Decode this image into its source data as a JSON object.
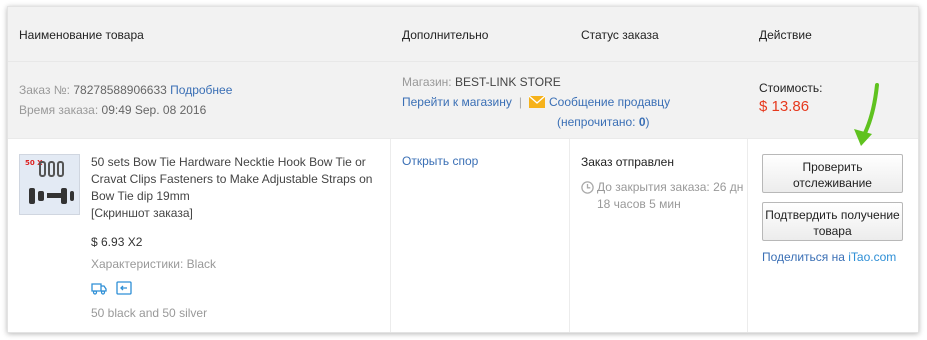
{
  "header": {
    "product_col": "Наименование товара",
    "extra_col": "Дополнительно",
    "status_col": "Статус заказа",
    "action_col": "Действие"
  },
  "order": {
    "number_label": "Заказ №:",
    "number": "78278588906633",
    "details_link": "Подробнее",
    "time_label": "Время заказа:",
    "time": "09:49 Sep. 08 2016",
    "store_label": "Магазин:",
    "store_name": "BEST-LINK STORE",
    "go_to_store": "Перейти к магазину",
    "separator": "|",
    "message_seller": "Сообщение продавцу",
    "unread_prefix": "(непрочитано:",
    "unread_count": "0",
    "unread_suffix": ")",
    "cost_label": "Стоимость:",
    "cost": "$ 13.86"
  },
  "product": {
    "image_badge": "50 X",
    "title": "50 sets Bow Tie Hardware Necktie Hook Bow Tie or Cravat Clips Fasteners to Make Adjustable Straps on Bow Tie dip 19mm",
    "snapshot": "[Скриншот заказа]",
    "unit_price": "$ 6.93 X2",
    "props_label": "Характеристики:",
    "props_value": "Black",
    "icons": [
      "delivery-truck-icon",
      "return-icon"
    ],
    "note": "50 black and 50 silver"
  },
  "extra": {
    "dispute_link": "Открыть спор"
  },
  "status": {
    "state": "Заказ отправлен",
    "countdown": "До закрытия заказа: 26 дн 18 часов 5 мин"
  },
  "actions": {
    "track_button": "Проверить отслеживание",
    "confirm_button": "Подтвердить получение товара",
    "share_prefix": "Поделиться на",
    "share_brand": "iTao.com"
  },
  "colors": {
    "link": "#3a6fb5",
    "price": "#e6391e",
    "arrow": "#5fc21f",
    "header_bg": "#f2f2f2"
  }
}
